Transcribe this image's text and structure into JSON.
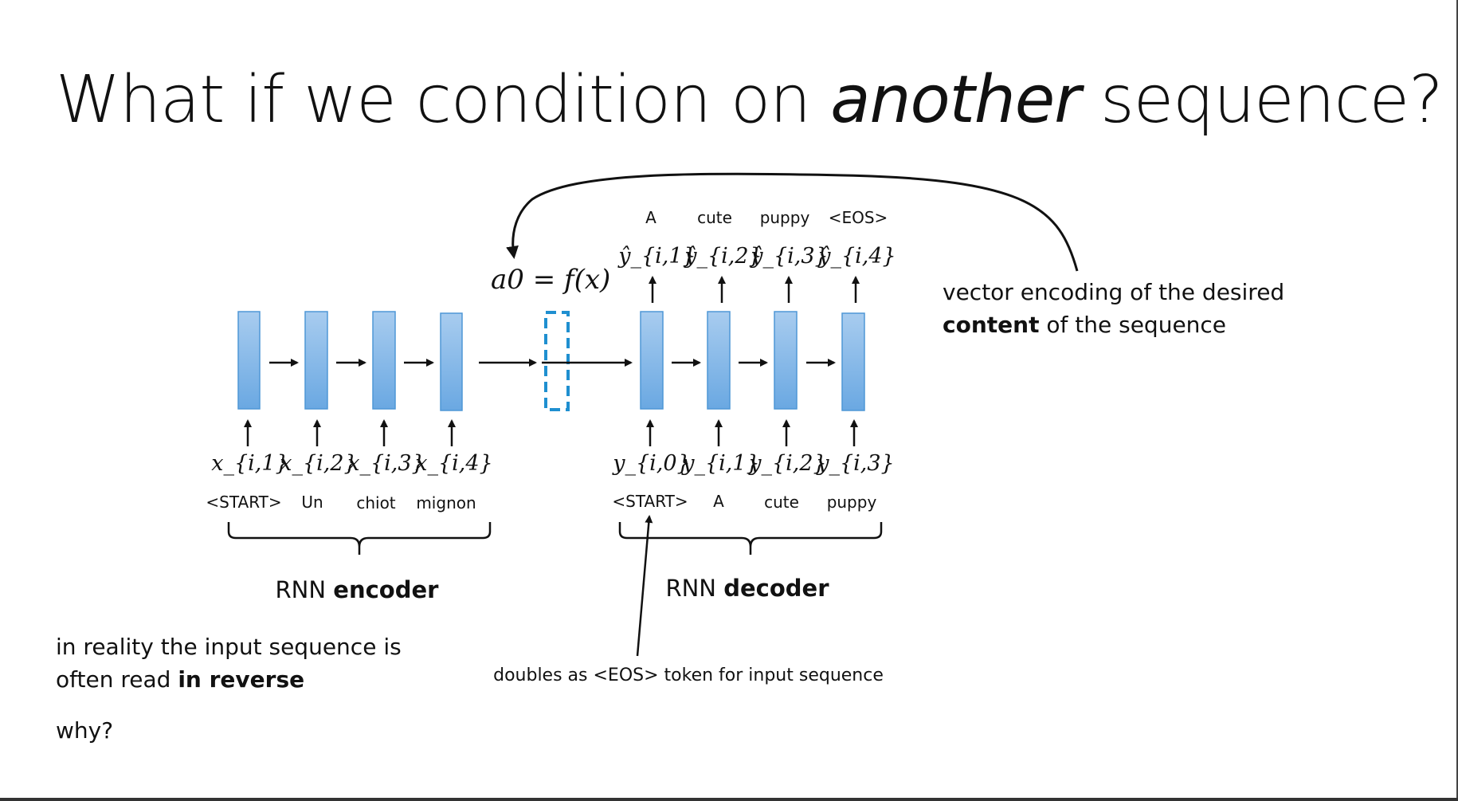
{
  "slide": {
    "title": {
      "prefix": "What if we condition on ",
      "emphasis": "another",
      "suffix": " sequence?"
    },
    "content_note": {
      "line1": "vector encoding of the desired",
      "bold": "content",
      "rest": " of the sequence"
    },
    "reverse_note": {
      "line1": "in reality the input sequence is",
      "line2_prefix": "often read ",
      "line2_bold": "in reverse"
    },
    "why": "why?",
    "initial_state": "a0 = f(x)",
    "eos_note": "doubles as <EOS> token for input sequence",
    "encoder": {
      "label_prefix": "RNN ",
      "label_bold": "encoder",
      "inputs": [
        "x_{i,1}",
        "x_{i,2}",
        "x_{i,3}",
        "x_{i,4}"
      ],
      "tokens": [
        "<START>",
        "Un",
        "chiot",
        "mignon"
      ]
    },
    "decoder": {
      "label_prefix": "RNN ",
      "label_bold": "decoder",
      "inputs": [
        "y_{i,0}",
        "y_{i,1}",
        "y_{i,2}",
        "y_{i,3}"
      ],
      "tokens": [
        "<START>",
        "A",
        "cute",
        "puppy"
      ],
      "outputs": [
        "ŷ_{i,1}",
        "ŷ_{i,2}",
        "ŷ_{i,3}",
        "ŷ_{i,4}"
      ],
      "output_tokens": [
        "A",
        "cute",
        "puppy",
        "<EOS>"
      ]
    },
    "colors": {
      "cell_fill_top": "#a8ccef",
      "cell_fill_bottom": "#6aa8e2",
      "cell_stroke": "#4f97d6",
      "context_dash": "#1f8fd0",
      "ink": "#111111"
    }
  }
}
